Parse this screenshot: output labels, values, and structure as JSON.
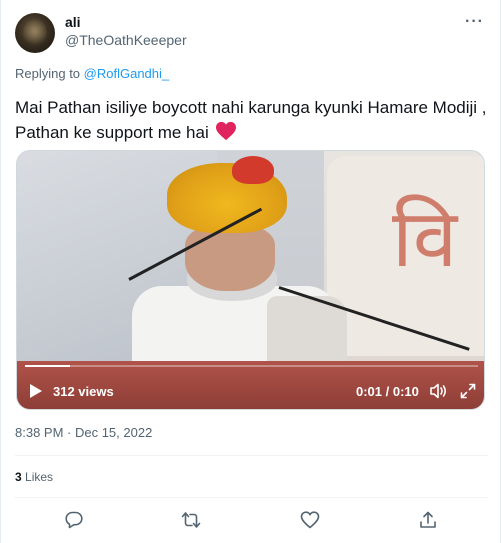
{
  "author": {
    "name": "ali",
    "handle": "@TheOathKeeeper"
  },
  "reply": {
    "prefix": "Replying to",
    "to": "@RoflGandhi_"
  },
  "tweet": {
    "text": "Mai Pathan isiliye boycott nahi karunga kyunki Hamare Modiji , Pathan ke support me hai"
  },
  "video": {
    "views": "312 views",
    "time": "0:01 / 0:10",
    "progress": 0.1
  },
  "meta": {
    "timestamp": "8:38 PM · Dec 15, 2022"
  },
  "stats": {
    "likes_count": "3",
    "likes_label": "Likes"
  },
  "colors": {
    "accent": "#1d9bf0",
    "heart": "#e0245e",
    "muted": "#536471"
  }
}
